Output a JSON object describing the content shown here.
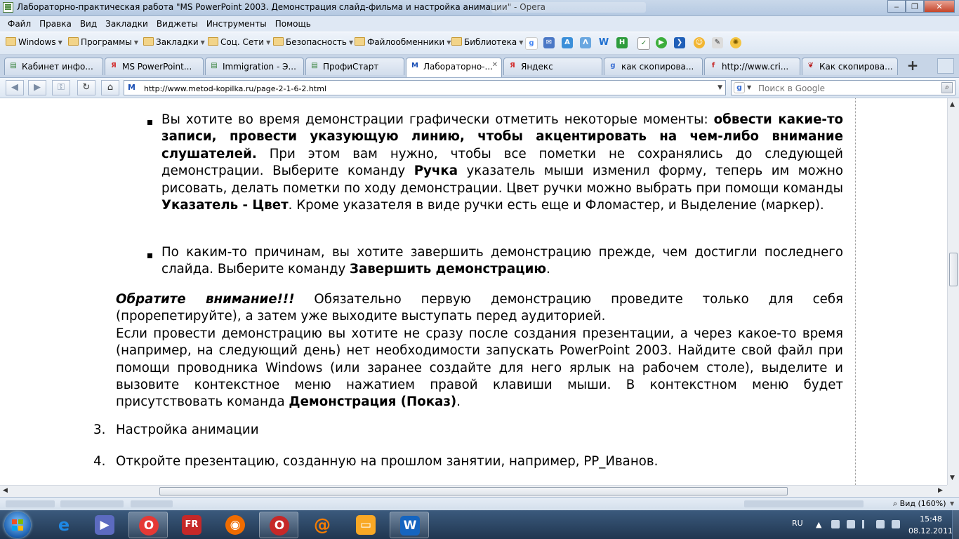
{
  "window": {
    "title": "Лабораторно-практическая работа \"MS PowerPoint 2003. Демонстрация слайд-фильма и настройка анимации\" - Opera",
    "minimize": "‒",
    "maximize": "❐",
    "close": "✕"
  },
  "menu": [
    "Файл",
    "Правка",
    "Вид",
    "Закладки",
    "Виджеты",
    "Инструменты",
    "Помощь"
  ],
  "bookmarks": {
    "folders": [
      "Windows",
      "Программы",
      "Закладки",
      "Соц. Сети",
      "Безопасность",
      "Файлообменники",
      "Библиотека"
    ],
    "icons": [
      "google-icon",
      "mail-icon",
      "translate-icon",
      "wiki-icon",
      "word-icon",
      "hh-icon",
      "checkbox-icon",
      "play-icon",
      "arrow-icon",
      "smile-icon",
      "pen-icon",
      "settings-icon"
    ]
  },
  "tabs": [
    {
      "label": "Кабинет инфо...",
      "icon": "page-icon",
      "fav": "▤",
      "fav_color": "#2e7d32",
      "active": false
    },
    {
      "label": "MS PowerPoint...",
      "icon": "yandex-icon",
      "fav": "Я",
      "fav_color": "#d32f2f",
      "active": false
    },
    {
      "label": "Immigration - Э...",
      "icon": "page-icon",
      "fav": "▤",
      "fav_color": "#2e7d32",
      "active": false
    },
    {
      "label": "ПрофиСтарт",
      "icon": "page-icon",
      "fav": "▤",
      "fav_color": "#2e7d32",
      "active": false
    },
    {
      "label": "Лабораторно-...",
      "icon": "metod-icon",
      "fav": "M",
      "fav_color": "#1a4fb5",
      "active": true
    },
    {
      "label": "Яндекс",
      "icon": "yandex-icon",
      "fav": "Я",
      "fav_color": "#d32f2f",
      "active": false
    },
    {
      "label": "как скопирова...",
      "icon": "google-icon",
      "fav": "g",
      "fav_color": "#3b6fd3",
      "active": false
    },
    {
      "label": "http://www.cri...",
      "icon": "flash-icon",
      "fav": "f",
      "fav_color": "#c62828",
      "active": false
    },
    {
      "label": "Как скопирова...",
      "icon": "bird-icon",
      "fav": "❦",
      "fav_color": "#b71c1c",
      "active": false
    }
  ],
  "tab_add": "+",
  "nav": {
    "back": "◀",
    "forward": "▶",
    "key": "⚿",
    "reload": "↻",
    "home": "⌂",
    "url": "http://www.metod-kopilka.ru/page-2-1-6-2.html",
    "search_placeholder": "Поиск в Google",
    "search_engine": "g"
  },
  "article": {
    "bullet1": {
      "t1": "Вы хотите во время демонстрации графически отметить некоторые моменты: ",
      "b1": "обвести какие-то записи, провести указующую линию, чтобы акцентировать на чем-либо внимание слушателей.",
      "t2": " При этом вам нужно, чтобы все пометки не сохранялись до следующей демонстрации. Выберите команду ",
      "b2": "Ручка",
      "t3": " указатель мыши изменил форму, теперь им можно рисовать, делать пометки по ходу демонстрации. Цвет ручки можно выбрать при помощи команды ",
      "b3": "Указатель - Цвет",
      "t4": ". Кроме указателя в виде ручки есть еще и Фломастер, и Выделение (маркер)."
    },
    "bullet2": {
      "t1": "По каким-то причинам, вы хотите завершить демонстрацию прежде, чем достигли последнего слайда. Выберите команду ",
      "b1": "Завершить демонстрацию",
      "t2": "."
    },
    "note": {
      "em": "Обратите внимание!!!",
      "t1": " Обязательно первую демонстрацию проведите только для себя (прорепетируйте), а затем уже выходите выступать перед аудиторией.",
      "t2": "Если провести демонстрацию вы хотите не сразу после создания презентации, а через какое-то время (например, на следующий день) нет необходимости запускать PowerPoint 2003. Найдите свой файл при помощи проводника Windows (или заранее создайте для него ярлык на рабочем столе), выделите и вызовите контекстное меню нажатием правой клавиши мыши. В контекстном меню будет присутствовать команда ",
      "b1": "Демонстрация (Показ)",
      "t3": "."
    },
    "items": [
      {
        "num": "3.",
        "text": "Настройка анимации"
      },
      {
        "num": "4.",
        "text": "Откройте презентацию, созданную на прошлом занятии, например, PP_Иванов."
      }
    ]
  },
  "status": {
    "zoom": "Вид (160%)"
  },
  "taskbar": {
    "apps": [
      {
        "name": "ie-icon",
        "glyph": "e",
        "color": "#1e88e5",
        "open": false
      },
      {
        "name": "media-icon",
        "glyph": "▶",
        "color": "#5c6bc0",
        "open": false
      },
      {
        "name": "opera-icon",
        "glyph": "O",
        "color": "#e53935",
        "open": true
      },
      {
        "name": "fr-icon",
        "glyph": "FR",
        "color": "#c62828",
        "open": false
      },
      {
        "name": "firefox-icon",
        "glyph": "◉",
        "color": "#ef6c00",
        "open": false
      },
      {
        "name": "opera2-icon",
        "glyph": "O",
        "color": "#c62828",
        "open": true
      },
      {
        "name": "mail-agent-icon",
        "glyph": "@",
        "color": "#f57c00",
        "open": false
      },
      {
        "name": "explorer-icon",
        "glyph": "▭",
        "color": "#f9a825",
        "open": false
      },
      {
        "name": "word-icon",
        "glyph": "W",
        "color": "#1565c0",
        "open": true
      }
    ],
    "lang": "RU",
    "time": "15:48",
    "date": "08.12.2011"
  }
}
